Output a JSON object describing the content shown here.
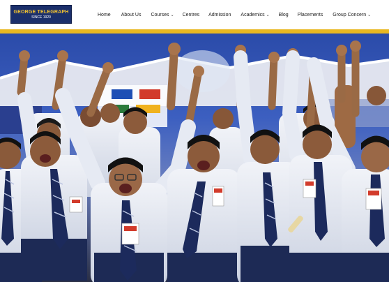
{
  "logo": {
    "name": "GEORGE TELEGRAPH",
    "since": "SINCE 1920"
  },
  "nav": {
    "items": [
      {
        "label": "Home",
        "has_dropdown": false
      },
      {
        "label": "About Us",
        "has_dropdown": false
      },
      {
        "label": "Courses",
        "has_dropdown": true
      },
      {
        "label": "Centres",
        "has_dropdown": false
      },
      {
        "label": "Admission",
        "has_dropdown": false
      },
      {
        "label": "Academics",
        "has_dropdown": true
      },
      {
        "label": "Blog",
        "has_dropdown": false
      },
      {
        "label": "Placements",
        "has_dropdown": false
      },
      {
        "label": "Group Concern",
        "has_dropdown": true
      }
    ]
  },
  "hero": {
    "image": "celebrating-students-photo",
    "colors": {
      "band": "#e9b821",
      "shirt": "#e8ecf4",
      "trousers": "#1d2a55"
    }
  }
}
